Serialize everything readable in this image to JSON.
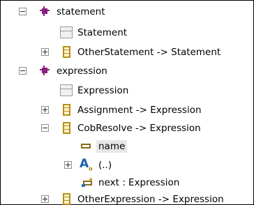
{
  "tree": {
    "statement": {
      "label": "statement",
      "children": {
        "statement_class": "Statement",
        "other_statement": "OtherStatement -> Statement"
      }
    },
    "expression": {
      "label": "expression",
      "children": {
        "expression_class": "Expression",
        "assignment": "Assignment -> Expression",
        "cobresolve": {
          "label": "CobResolve -> Expression",
          "children": {
            "name": "name",
            "operation": "(..)",
            "next": "next : Expression"
          }
        },
        "other_expression": "OtherExpression -> Expression"
      }
    }
  },
  "colors": {
    "package_icon": "#8a1f7f",
    "class_icon_border": "#b78e1a",
    "class_icon_fill": "#fff3c9",
    "selection_bg": "#e7e7e7"
  },
  "icons": {
    "package": "package-icon",
    "abstract_class": "abstract-class-icon",
    "class": "eclass-icon",
    "attribute": "eattribute-icon",
    "operation": "eoperation-icon",
    "reference": "ereference-icon"
  }
}
